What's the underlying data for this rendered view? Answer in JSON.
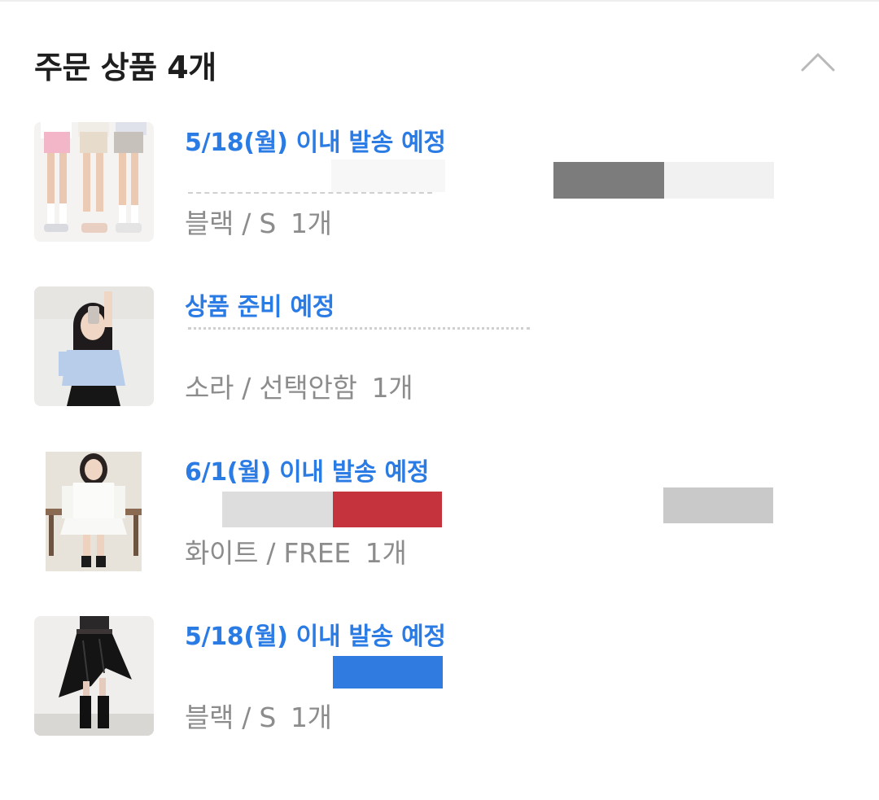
{
  "section": {
    "title": "주문 상품 4개",
    "toggle_icon": "chevron-up-icon"
  },
  "colors": {
    "accent": "#2b7be4",
    "option_text": "#8c8c8c",
    "title_text": "#1e1e1e"
  },
  "items": [
    {
      "ship_status": "5/18(월) 이내 발송 예정",
      "option": "블랙 / S",
      "quantity": "1개",
      "thumbnail": "product-shorts-photo"
    },
    {
      "ship_status": "상품 준비 예정",
      "option": "소라 / 선택안함",
      "quantity": "1개",
      "thumbnail": "product-blouse-photo"
    },
    {
      "ship_status": "6/1(월) 이내 발송 예정",
      "option": "화이트 / FREE",
      "quantity": "1개",
      "thumbnail": "product-white-top-photo"
    },
    {
      "ship_status": "5/18(월) 이내 발송 예정",
      "option": "블랙 / S",
      "quantity": "1개",
      "thumbnail": "product-black-skirt-photo"
    }
  ]
}
